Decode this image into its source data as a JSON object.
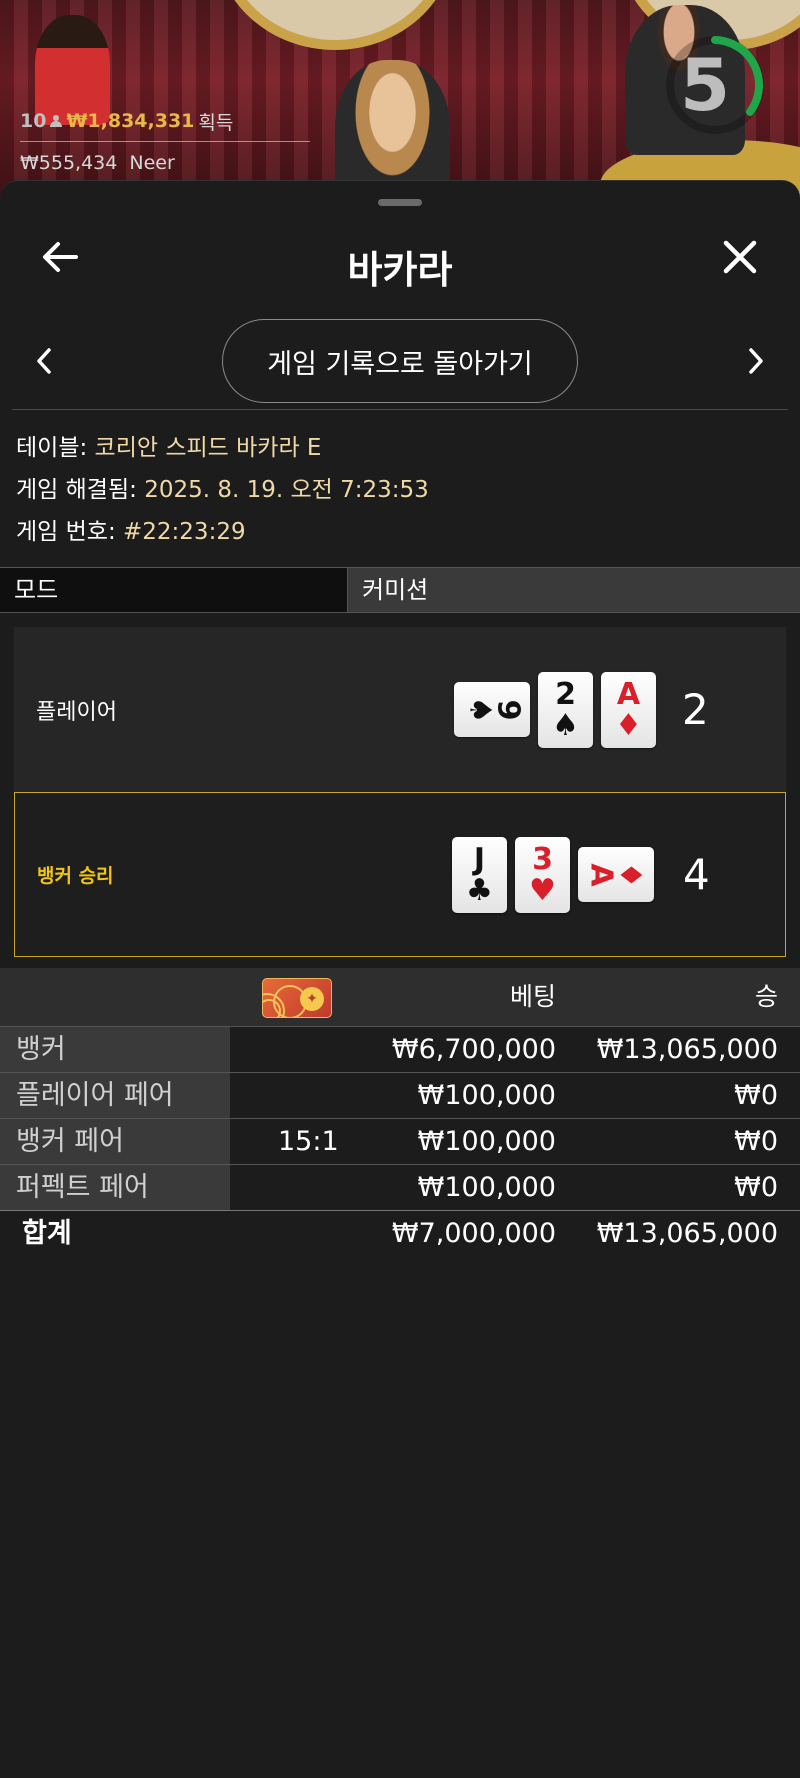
{
  "overlay": {
    "players": "10",
    "winnings": "₩1,834,331",
    "winnings_label": "획득",
    "balance": "₩555,434",
    "username": "Neer",
    "timer": "5"
  },
  "header": {
    "title": "바카라"
  },
  "nav": {
    "history_button": "게임 기록으로 돌아가기"
  },
  "info": {
    "table_label": "테이블:",
    "table_value": "코리안 스피드 바카라 E",
    "resolved_label": "게임 해결됨:",
    "resolved_value": "2025. 8. 19. 오전 7:23:53",
    "number_label": "게임 번호:",
    "number_value": "#22:23:29"
  },
  "mode": {
    "label": "모드",
    "value": "커미션"
  },
  "hands": [
    {
      "label": "플레이어",
      "score": "2",
      "cards": [
        {
          "rank": "9",
          "suit": "♠",
          "color": "black",
          "sideways": true
        },
        {
          "rank": "2",
          "suit": "♠",
          "color": "black",
          "sideways": false
        },
        {
          "rank": "A",
          "suit": "♦",
          "color": "red",
          "sideways": false
        }
      ]
    },
    {
      "label": "뱅커 승리",
      "score": "4",
      "cards": [
        {
          "rank": "J",
          "suit": "♣",
          "color": "black",
          "sideways": false
        },
        {
          "rank": "3",
          "suit": "♥",
          "color": "red",
          "sideways": false
        },
        {
          "rank": "A",
          "suit": "♦",
          "color": "red",
          "sideways": true
        }
      ]
    }
  ],
  "bets": {
    "header_bet": "베팅",
    "header_win": "승",
    "rows": [
      {
        "name": "뱅커",
        "odds": "",
        "bet": "₩6,700,000",
        "win": "₩13,065,000"
      },
      {
        "name": "플레이어 페어",
        "odds": "",
        "bet": "₩100,000",
        "win": "₩0"
      },
      {
        "name": "뱅커 페어",
        "odds": "15:1",
        "bet": "₩100,000",
        "win": "₩0"
      },
      {
        "name": "퍼펙트 페어",
        "odds": "",
        "bet": "₩100,000",
        "win": "₩0"
      }
    ],
    "total": {
      "name": "합계",
      "bet": "₩7,000,000",
      "win": "₩13,065,000"
    }
  },
  "colors": {
    "gold_text": "#e8b84a",
    "winner_border": "#c8a82a",
    "timer_ring": "#1fa64a",
    "card_red": "#d9202a"
  }
}
